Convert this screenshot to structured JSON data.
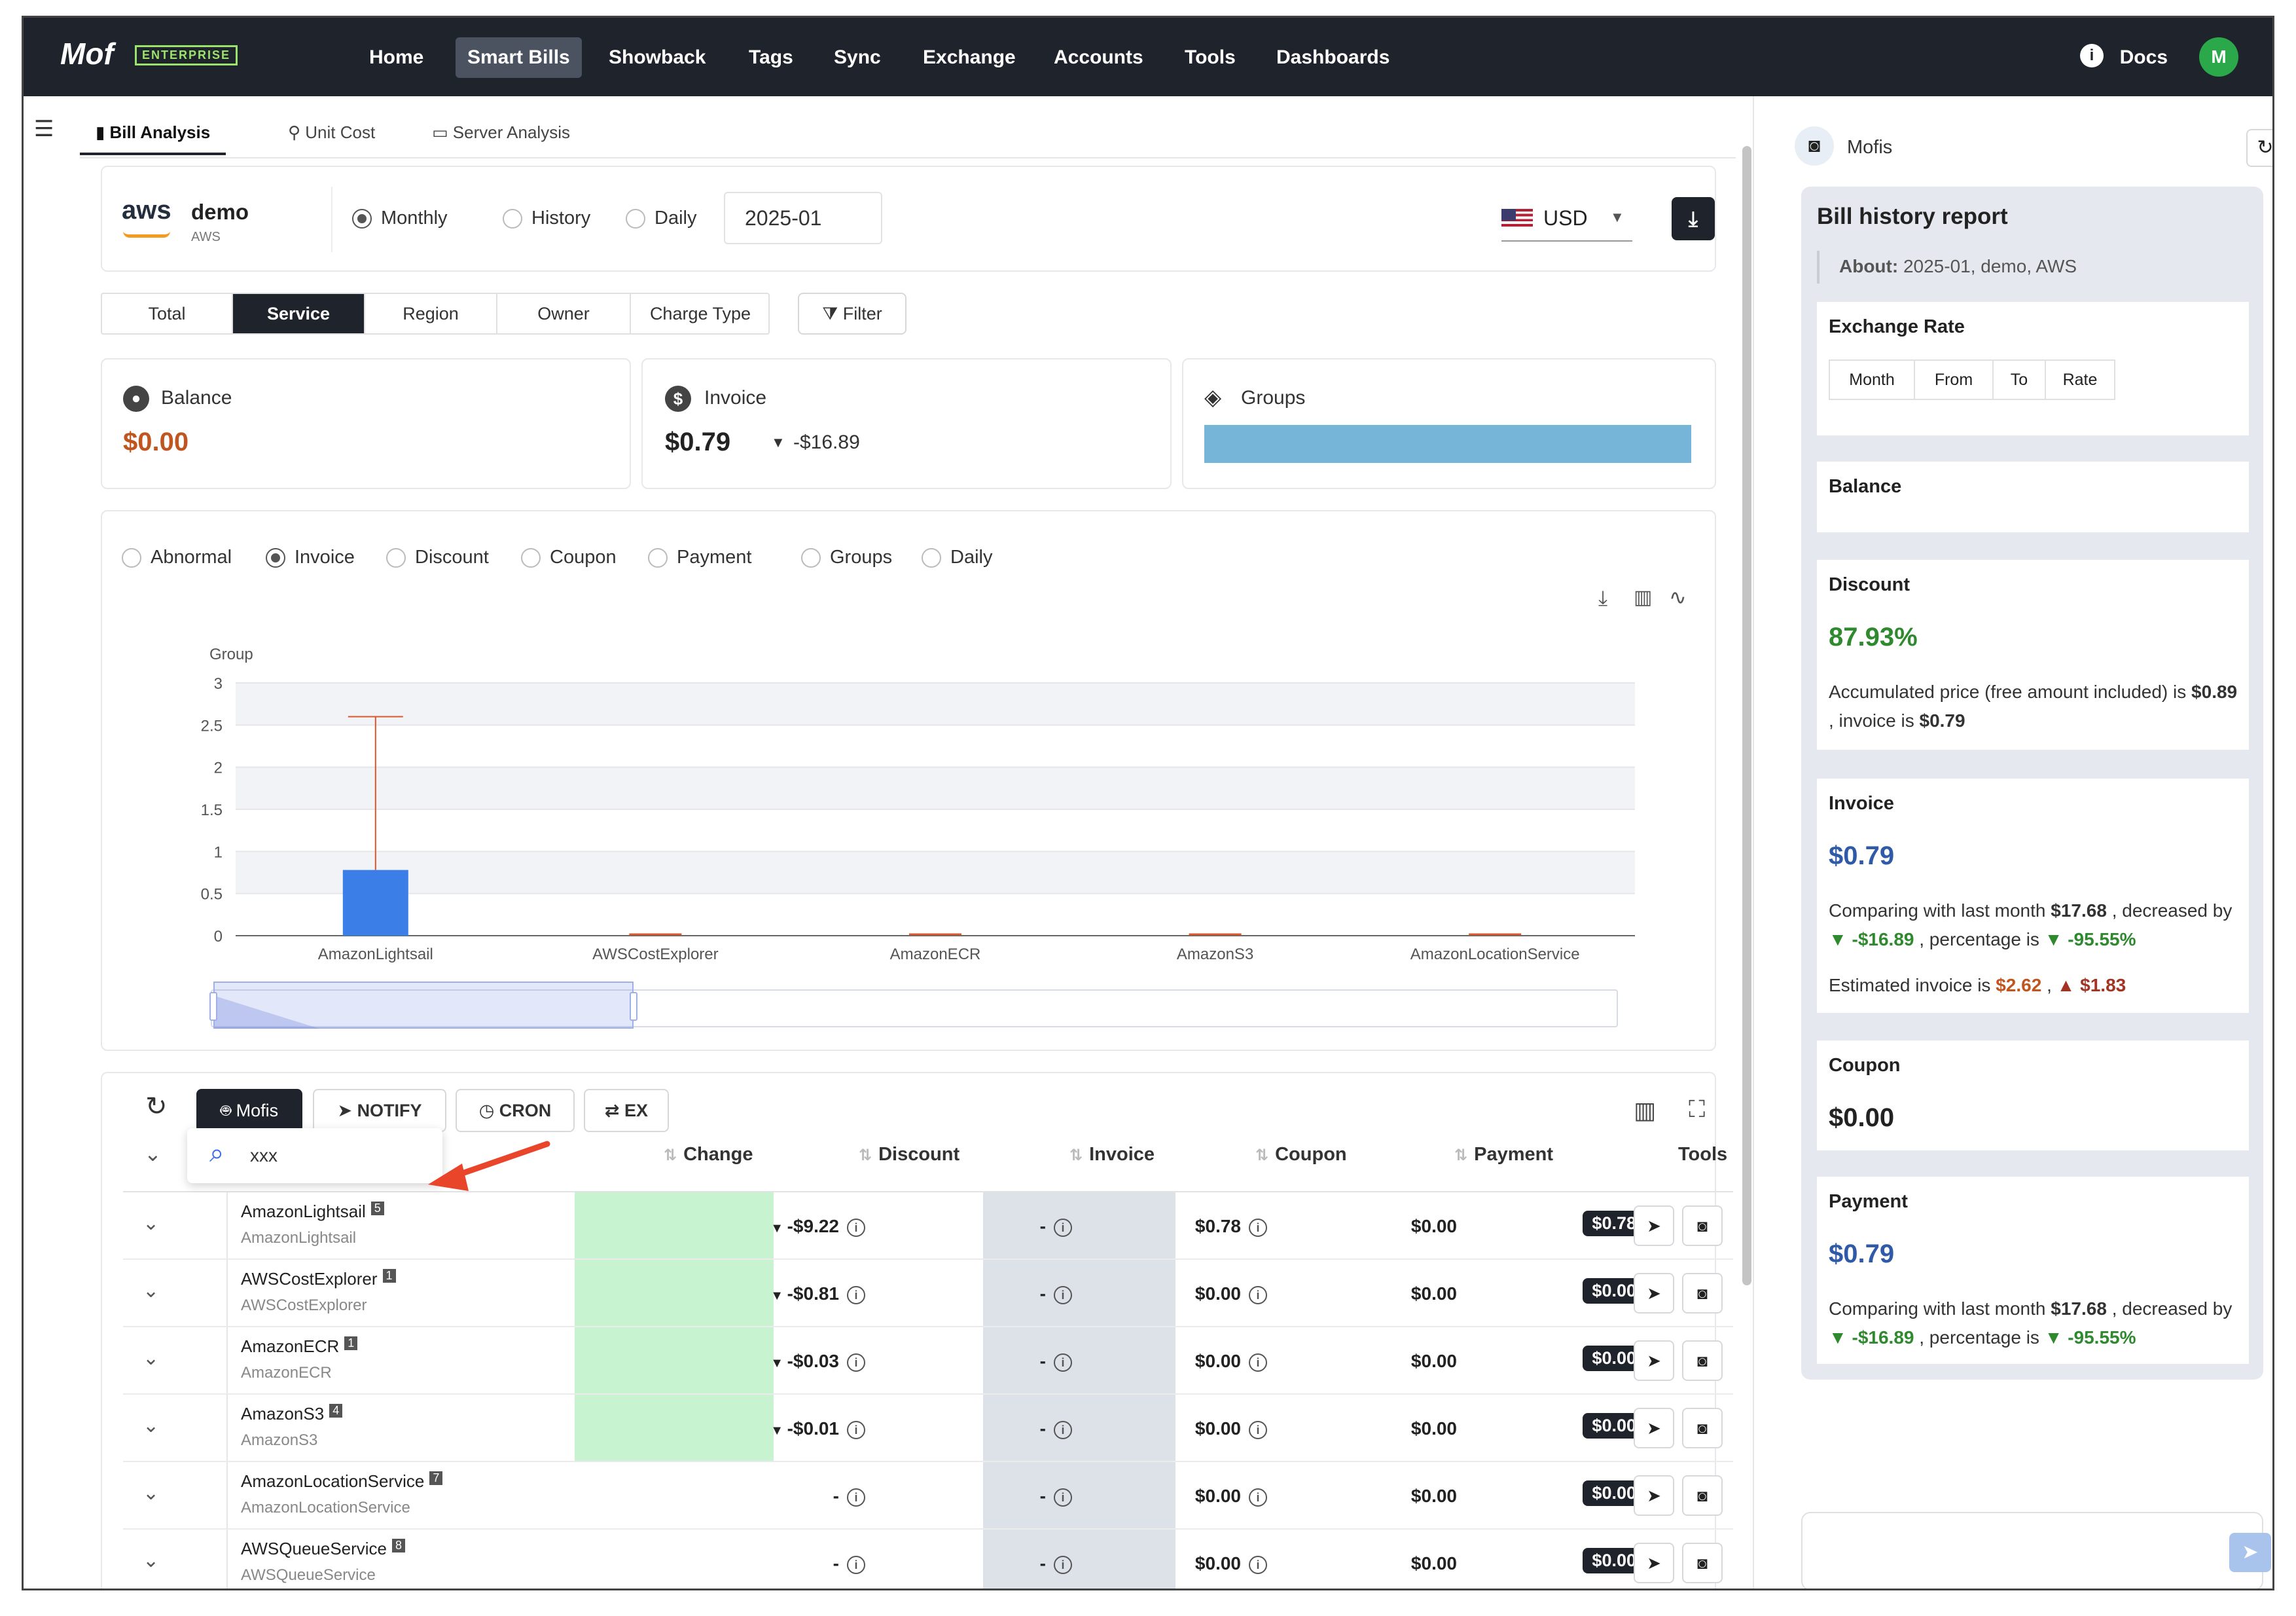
{
  "nav": {
    "logo": "Mof",
    "edition": "ENTERPRISE",
    "items": [
      "Home",
      "Smart Bills",
      "Showback",
      "Tags",
      "Sync",
      "Exchange",
      "Accounts",
      "Tools",
      "Dashboards"
    ],
    "active": "Smart Bills",
    "docs": "Docs",
    "avatar": "M"
  },
  "tabs": [
    "Bill Analysis",
    "Unit Cost",
    "Server Analysis"
  ],
  "account": {
    "provider_logo": "aws",
    "name": "demo",
    "provider": "AWS"
  },
  "period": {
    "options": [
      "Monthly",
      "History",
      "Daily"
    ],
    "selected": "Monthly",
    "month": "2025-01"
  },
  "currency": "USD",
  "dimensions": {
    "options": [
      "Total",
      "Service",
      "Region",
      "Owner",
      "Charge Type"
    ],
    "selected": "Service",
    "filter_label": "Filter"
  },
  "summary": {
    "balance_label": "Balance",
    "balance_value": "$0.00",
    "invoice_label": "Invoice",
    "invoice_value": "$0.79",
    "invoice_change": "-$16.89",
    "groups_label": "Groups"
  },
  "chart_modes": {
    "options": [
      "Abnormal",
      "Invoice",
      "Discount",
      "Coupon",
      "Payment",
      "Groups",
      "Daily"
    ],
    "selected": "Invoice"
  },
  "chart_data": {
    "type": "bar",
    "ylabel": "Group",
    "ylim": [
      0,
      3
    ],
    "yticks": [
      "0",
      "0.5",
      "1",
      "1.5",
      "2",
      "2.5",
      "3"
    ],
    "categories": [
      "AmazonLightsail",
      "AWSCostExplorer",
      "AmazonECR",
      "AmazonS3",
      "AmazonLocationService"
    ],
    "values": [
      0.78,
      0,
      0,
      0,
      0
    ],
    "error_high": [
      2.6,
      0,
      0,
      0,
      0
    ],
    "colors": {
      "bar": "#3c7ee8",
      "error": "#d9572b",
      "band": "#f2f3f6"
    }
  },
  "table_toolbar": {
    "mofis": "Mofis",
    "notify": "NOTIFY",
    "cron": "CRON",
    "ex": "EX"
  },
  "search_popup": {
    "value": "xxx"
  },
  "table": {
    "headers": [
      "Change",
      "Discount",
      "Invoice",
      "Coupon",
      "Payment",
      "Tools"
    ],
    "rows": [
      {
        "name": "AmazonLightsail",
        "count": "5",
        "sub": "AmazonLightsail",
        "change": "-$9.22",
        "discount": "-",
        "invoice": "$0.78",
        "coupon": "$0.00",
        "payment": "$0.78"
      },
      {
        "name": "AWSCostExplorer",
        "count": "1",
        "sub": "AWSCostExplorer",
        "change": "-$0.81",
        "discount": "-",
        "invoice": "$0.00",
        "coupon": "$0.00",
        "payment": "$0.00"
      },
      {
        "name": "AmazonECR",
        "count": "1",
        "sub": "AmazonECR",
        "change": "-$0.03",
        "discount": "-",
        "invoice": "$0.00",
        "coupon": "$0.00",
        "payment": "$0.00"
      },
      {
        "name": "AmazonS3",
        "count": "4",
        "sub": "AmazonS3",
        "change": "-$0.01",
        "discount": "-",
        "invoice": "$0.00",
        "coupon": "$0.00",
        "payment": "$0.00"
      },
      {
        "name": "AmazonLocationService",
        "count": "7",
        "sub": "AmazonLocationService",
        "change": "-",
        "discount": "-",
        "invoice": "$0.00",
        "coupon": "$0.00",
        "payment": "$0.00"
      },
      {
        "name": "AWSQueueService",
        "count": "8",
        "sub": "AWSQueueService",
        "change": "-",
        "discount": "-",
        "invoice": "$0.00",
        "coupon": "$0.00",
        "payment": "$0.00"
      }
    ]
  },
  "panel": {
    "bot_name": "Mofis",
    "title": "Bill history report",
    "about_label": "About:",
    "about_value": "2025-01, demo, AWS",
    "exchange_title": "Exchange Rate",
    "exchange_cols": [
      "Month",
      "From",
      "To",
      "Rate"
    ],
    "balance_title": "Balance",
    "discount_title": "Discount",
    "discount_value": "87.93%",
    "discount_text_1": "Accumulated price (free amount included) is",
    "discount_price": "$0.89",
    "discount_text_2": ", invoice is",
    "discount_invoice": "$0.79",
    "invoice_title": "Invoice",
    "invoice_value": "$0.79",
    "compare_text": "Comparing with last month",
    "compare_last": "$17.68",
    "compare_decreased": ", decreased",
    "compare_by": "by",
    "compare_diff": "-$16.89",
    "compare_pct_label": ", percentage is",
    "compare_pct": "-95.55%",
    "estimated_label": "Estimated invoice is",
    "estimated_value": "$2.62",
    "estimated_delta": "$1.83",
    "coupon_title": "Coupon",
    "coupon_value": "$0.00",
    "payment_title": "Payment",
    "payment_value": "$0.79",
    "pay_compare_last": "$17.68",
    "pay_compare_diff": "-$16.89",
    "pay_compare_pct": "-95.55%"
  }
}
